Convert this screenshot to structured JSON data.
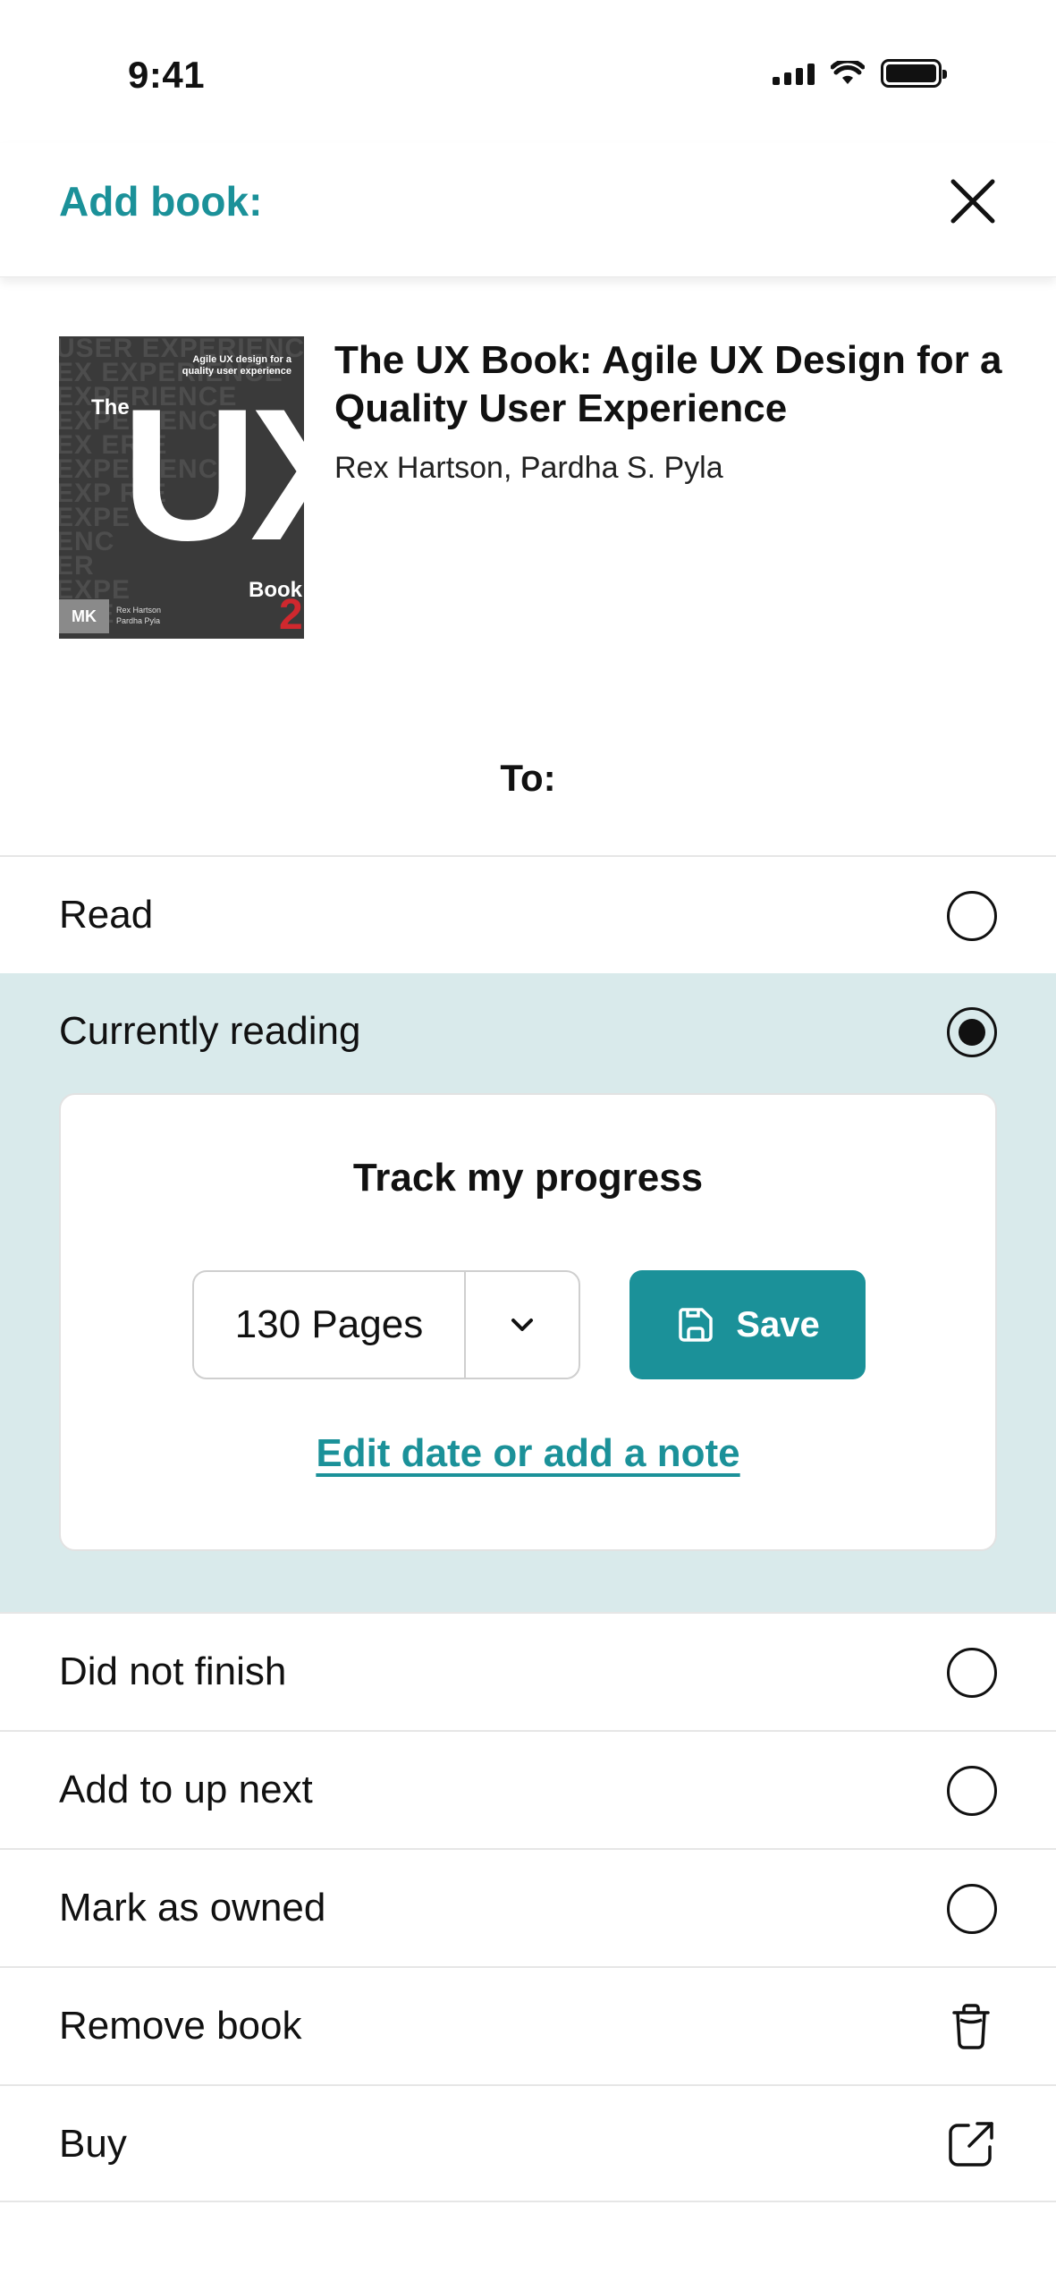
{
  "status_bar": {
    "time": "9:41"
  },
  "header": {
    "title": "Add book:"
  },
  "book": {
    "title": "The UX Book: Agile UX Design for a Quality User Experience",
    "authors": "Rex Hartson, Pardha S. Pyla"
  },
  "to_label": "To:",
  "options": {
    "read": {
      "label": "Read",
      "selected": false
    },
    "currently_reading": {
      "label": "Currently reading",
      "selected": true
    },
    "did_not_finish": {
      "label": "Did not finish",
      "selected": false
    },
    "add_to_up_next": {
      "label": "Add to up next",
      "selected": false
    },
    "mark_as_owned": {
      "label": "Mark as owned",
      "selected": false
    },
    "remove_book": {
      "label": "Remove book",
      "icon": "trash-icon"
    },
    "buy": {
      "label": "Buy",
      "icon": "external-link-icon"
    }
  },
  "progress": {
    "title": "Track my progress",
    "pages_value": "130 Pages",
    "save_label": "Save",
    "edit_link": "Edit date or add a note"
  },
  "colors": {
    "accent": "#1b9199",
    "selected_section_bg": "#d9eaeb"
  }
}
